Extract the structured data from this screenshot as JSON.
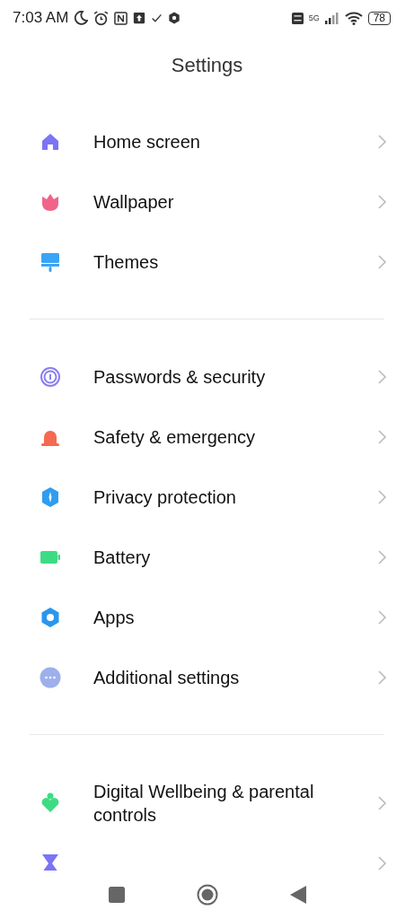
{
  "status_bar": {
    "time": "7:03 AM",
    "network": "5G",
    "battery": "78"
  },
  "title": "Settings",
  "groups": [
    {
      "items": [
        {
          "label": "Home screen",
          "kind": "home",
          "color": "#7b74f5"
        },
        {
          "label": "Wallpaper",
          "kind": "tulip",
          "color": "#f0648a"
        },
        {
          "label": "Themes",
          "kind": "brush",
          "color": "#3aa4f5"
        }
      ]
    },
    {
      "items": [
        {
          "label": "Passwords & security",
          "kind": "fingerprint",
          "color": "#8a7ef0"
        },
        {
          "label": "Safety & emergency",
          "kind": "siren",
          "color": "#f56a50"
        },
        {
          "label": "Privacy protection",
          "kind": "shield",
          "color": "#2f9df0"
        },
        {
          "label": "Battery",
          "kind": "battery",
          "color": "#3ddc84"
        },
        {
          "label": "Apps",
          "kind": "gear",
          "color": "#2a96ee"
        },
        {
          "label": "Additional settings",
          "kind": "dots",
          "color": "#9db0ec"
        }
      ]
    },
    {
      "items": [
        {
          "label": "Digital Wellbeing & parental controls",
          "kind": "wellbeing",
          "color": "#3ddc84"
        },
        {
          "kind": "hourglass",
          "color": "#7b74f5"
        }
      ]
    }
  ]
}
